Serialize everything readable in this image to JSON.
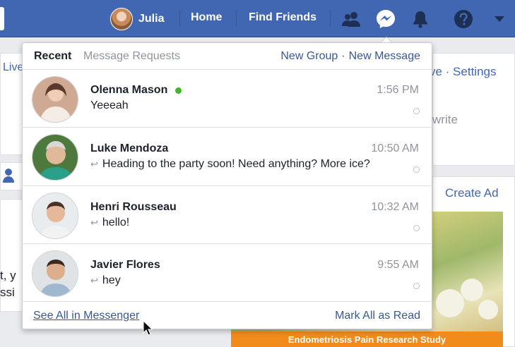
{
  "topnav": {
    "user_name": "Julia",
    "home_label": "Home",
    "find_friends_label": "Find Friends"
  },
  "background": {
    "live_text": "Live",
    "left_fragment_1": "t, y",
    "left_fragment_2": "ssi",
    "right_links": "ve · Settings",
    "write_text": "write",
    "create_ad": "Create Ad",
    "ad_caption": "Endometriosis Pain Research Study"
  },
  "dropdown": {
    "tab_recent": "Recent",
    "tab_requests": "Message Requests",
    "new_group": "New Group",
    "separator": "·",
    "new_message": "New Message",
    "threads": [
      {
        "name": "Olenna Mason",
        "time": "1:56 PM",
        "snippet": "Yeeeah",
        "online": true,
        "replied": false
      },
      {
        "name": "Luke Mendoza",
        "time": "10:50 AM",
        "snippet": "Heading to the party soon! Need anything? More ice?",
        "online": false,
        "replied": true
      },
      {
        "name": "Henri Rousseau",
        "time": "10:32 AM",
        "snippet": "hello!",
        "online": false,
        "replied": true
      },
      {
        "name": "Javier Flores",
        "time": "9:55 AM",
        "snippet": "hey",
        "online": false,
        "replied": true
      }
    ],
    "see_all": "See All in Messenger",
    "mark_all": "Mark All as Read"
  },
  "colors": {
    "topbar": "#4267b2",
    "link": "#365899",
    "online": "#42b72a",
    "ad_banner": "#f18c1c"
  },
  "icons": [
    "friends-icon",
    "messenger-icon",
    "notifications-bell-icon",
    "help-icon",
    "menu-caret-icon",
    "reply-arrow-icon",
    "mouse-cursor-icon"
  ]
}
